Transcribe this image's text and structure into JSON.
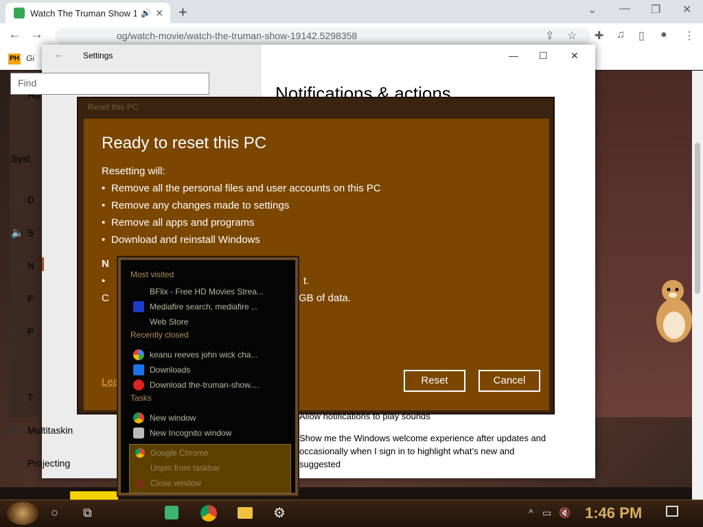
{
  "browser": {
    "tab_title": "Watch The Truman Show 1",
    "url": "og/watch-movie/watch-the-truman-show-19142.5298358",
    "bookmark_ph": "PH",
    "bookmark_gi": "Gi"
  },
  "settings": {
    "window_title": "Settings",
    "page_heading": "Notifications & actions",
    "find_placeholder": "Find",
    "side_items": [
      {
        "label": "Ho",
        "icon": "home-icon"
      },
      {
        "label": "Syst",
        "icon": ""
      },
      {
        "label": "D",
        "icon": "display-icon"
      },
      {
        "label": "S",
        "icon": "sound-icon"
      },
      {
        "label": "N",
        "icon": "notifications-icon"
      },
      {
        "label": "F",
        "icon": "focus-icon"
      },
      {
        "label": "P",
        "icon": "power-icon"
      },
      {
        "label": "T",
        "icon": "tablet-icon"
      },
      {
        "label": "Multitaskin",
        "icon": "multitasking-icon"
      },
      {
        "label": "Projecting",
        "icon": "projecting-icon"
      }
    ],
    "option1": "Allow notifications to play sounds",
    "option2_line1": "Show me the Windows welcome experience after updates and",
    "option2_line2": "occasionally when I sign in to highlight what’s new and",
    "option2_line3": "suggested"
  },
  "reset_dialog": {
    "titlebar": "Reset this PC",
    "heading": "Ready to reset this PC",
    "subheading": "Resetting will:",
    "bullets": [
      "Remove all the personal files and user accounts on this PC",
      "Remove any changes made to settings",
      "Remove all apps and programs",
      "Download and reinstall Windows"
    ],
    "partial_heading": "N",
    "frag1": "t.",
    "frag2": "GB of data.",
    "learn_more": "Lea",
    "reset_label": "Reset",
    "cancel_label": "Cancel"
  },
  "jumplist": {
    "most_visited_label": "Most visited",
    "most_visited": [
      {
        "label": "BFlix - Free HD Movies Strea...",
        "icon": "bflix-icon"
      },
      {
        "label": "Mediafire search, mediafire ...",
        "icon": "mediafire-icon"
      },
      {
        "label": "Web Store",
        "icon": "webstore-icon"
      }
    ],
    "recently_closed_label": "Recently closed",
    "recently_closed": [
      {
        "label": "keanu reeves john wick cha...",
        "icon": "google-icon"
      },
      {
        "label": "Downloads",
        "icon": "downloads-icon"
      },
      {
        "label": "Download the-truman-show....",
        "icon": "download-site-icon"
      }
    ],
    "tasks_label": "Tasks",
    "tasks": [
      {
        "label": "New window",
        "icon": "chrome-icon"
      },
      {
        "label": "New Incognito window",
        "icon": "incognito-icon"
      }
    ],
    "bottom": [
      {
        "label": "Google Chrome",
        "icon": "chrome-icon"
      },
      {
        "label": "Unpin from taskbar",
        "icon": "unpin-icon"
      },
      {
        "label": "Close window",
        "icon": "close-window-icon"
      }
    ]
  },
  "taskbar": {
    "clock": "1:46 PM"
  }
}
